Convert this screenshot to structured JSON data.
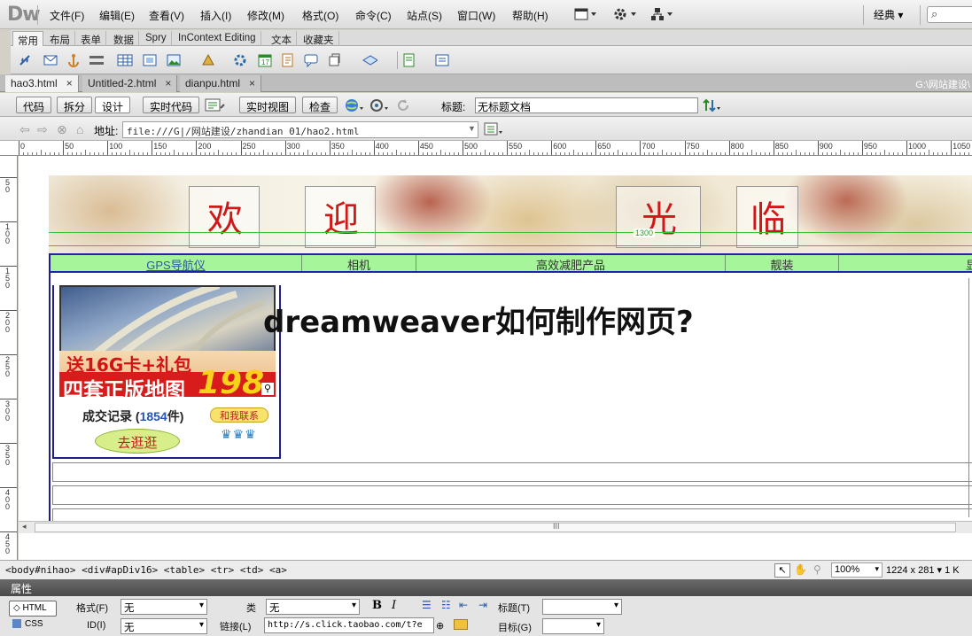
{
  "app": {
    "logo": "Dw",
    "menus": [
      "文件(F)",
      "编辑(E)",
      "查看(V)",
      "插入(I)",
      "修改(M)",
      "格式(O)",
      "命令(C)",
      "站点(S)",
      "窗口(W)",
      "帮助(H)"
    ],
    "workspace": "经典 ▾",
    "search_icon": "⌕"
  },
  "insert_panel": {
    "tabs": [
      "常用",
      "布局",
      "表单",
      "数据",
      "Spry",
      "InContext Editing",
      "文本",
      "收藏夹"
    ],
    "active_tab": "常用"
  },
  "documents": {
    "tabs": [
      {
        "label": "hao3.html",
        "close": "×"
      },
      {
        "label": "Untitled-2.html",
        "close": "×"
      },
      {
        "label": "dianpu.html",
        "close": "×"
      }
    ],
    "path": "G:\\网站建设\\"
  },
  "doc_toolbar": {
    "views": [
      "代码",
      "拆分",
      "设计",
      "实时代码"
    ],
    "live_view": "实时视图",
    "inspect": "检查",
    "title_label": "标题:",
    "title_value": "无标题文档"
  },
  "address_bar": {
    "label": "地址:",
    "value": "file:///G|/网站建设/zhandian 01/hao2.html"
  },
  "ruler": {
    "h_ticks": [
      "0",
      "50",
      "100",
      "150",
      "200",
      "250",
      "300",
      "350",
      "400",
      "450",
      "500",
      "550",
      "600",
      "650",
      "700",
      "750",
      "800",
      "850",
      "900",
      "950",
      "1000",
      "1050"
    ],
    "v_ticks": [
      "5\n0",
      "1\n0\n0",
      "1\n5\n0",
      "2\n0\n0",
      "2\n5\n0",
      "3\n0\n0",
      "3\n5\n0",
      "4\n0\n0",
      "4\n5\n0"
    ]
  },
  "page": {
    "welcome_chars": [
      "欢",
      "迎",
      "光",
      "临"
    ],
    "table_width_label": "1300",
    "nav_items": [
      "GPS导航仪",
      "相机",
      "高效减肥产品",
      "靓装",
      "显"
    ],
    "overlay_title": "dreamweaver如何制作网页?",
    "product": {
      "promo_line1": "送16G卡+礼包",
      "promo_line2": "四套正版地图",
      "price": "198",
      "deal_prefix": "成交记录 (",
      "deal_count": "1854",
      "deal_suffix": "件)",
      "contact": "和我联系",
      "go": "去逛逛",
      "stars": "♛♛♛"
    }
  },
  "hscroll": {
    "grip": "III",
    "left_arrow": "◂"
  },
  "statusbar": {
    "tag_selector": "<body#nihao> <div#apDiv16> <table> <tr> <td> <a>",
    "zoom": "100%",
    "size": "1224 x 281 ▾  1 K"
  },
  "properties": {
    "title": "属性",
    "html_btn": "◇ HTML",
    "css_btn": "CSS",
    "format_label": "格式(F)",
    "format_value": "无",
    "id_label": "ID(I)",
    "id_value": "无",
    "class_label": "类",
    "class_value": "无",
    "link_label": "链接(L)",
    "link_value": "http://s.click.taobao.com/t?e",
    "bold": "B",
    "italic": "I",
    "heading_label": "标题(T)",
    "heading_value": "",
    "target_label": "目标(G)",
    "target_value": ""
  },
  "colors": {
    "nav_bg": "#a7f59a",
    "accent_red": "#d01818",
    "table_border": "#1f1f8a"
  }
}
